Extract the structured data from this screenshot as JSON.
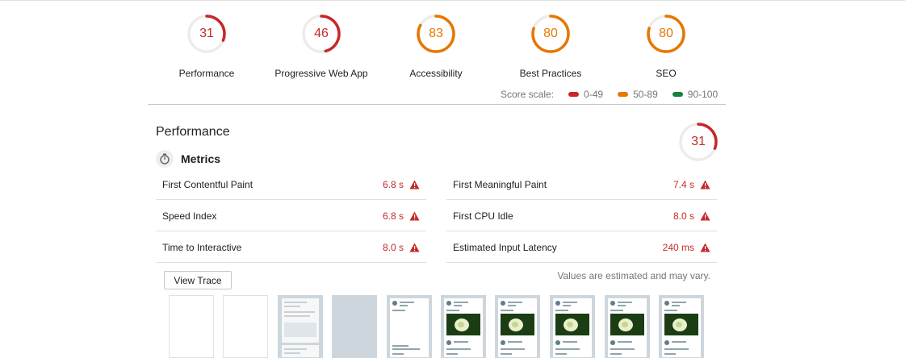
{
  "gauges": [
    {
      "score": "31",
      "label": "Performance",
      "fraction": 0.31,
      "color": "#c62828"
    },
    {
      "score": "46",
      "label": "Progressive Web App",
      "fraction": 0.46,
      "color": "#c62828"
    },
    {
      "score": "83",
      "label": "Accessibility",
      "fraction": 0.83,
      "color": "#e67700"
    },
    {
      "score": "80",
      "label": "Best Practices",
      "fraction": 0.8,
      "color": "#e67700"
    },
    {
      "score": "80",
      "label": "SEO",
      "fraction": 0.8,
      "color": "#e67700"
    }
  ],
  "score_scale": {
    "label": "Score scale:",
    "ranges": [
      {
        "text": "0-49",
        "color": "#c62828"
      },
      {
        "text": "50-89",
        "color": "#e67700"
      },
      {
        "text": "90-100",
        "color": "#178239"
      }
    ]
  },
  "performance": {
    "title": "Performance",
    "score": "31",
    "fraction": 0.31,
    "color": "#c62828",
    "metrics_title": "Metrics",
    "metrics_icon": "stopwatch-icon",
    "metrics": [
      {
        "label": "First Contentful Paint",
        "value": "6.8 s"
      },
      {
        "label": "First Meaningful Paint",
        "value": "7.4 s"
      },
      {
        "label": "Speed Index",
        "value": "6.8 s"
      },
      {
        "label": "First CPU Idle",
        "value": "8.0 s"
      },
      {
        "label": "Time to Interactive",
        "value": "8.0 s"
      },
      {
        "label": "Estimated Input Latency",
        "value": "240 ms"
      }
    ],
    "view_trace_label": "View Trace",
    "estimate_note": "Values are estimated and may vary.",
    "filmstrip_frames": [
      "blank",
      "blank",
      "skeleton",
      "gray",
      "page-text",
      "page-photo",
      "page-photo",
      "page-photo",
      "page-photo",
      "page-photo"
    ]
  }
}
